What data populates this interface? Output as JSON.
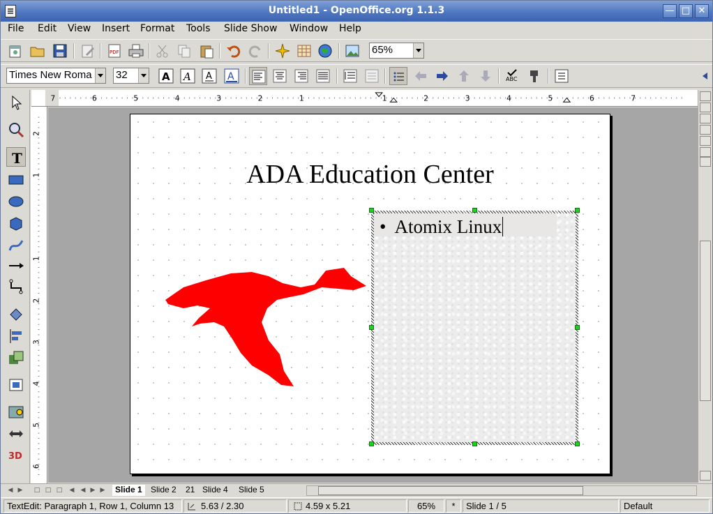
{
  "window": {
    "title": "Untitled1 - OpenOffice.org 1.1.3"
  },
  "menu": [
    "File",
    "Edit",
    "View",
    "Insert",
    "Format",
    "Tools",
    "Slide Show",
    "Window",
    "Help"
  ],
  "toolbar": {
    "zoom_value": "65%"
  },
  "format_bar": {
    "font_name": "Times New Roma",
    "font_size": "32"
  },
  "rulers": {
    "horizontal_ticks": [
      "7",
      "6",
      "5",
      "4",
      "3",
      "2",
      "1",
      "1",
      "2",
      "3",
      "4",
      "5",
      "6",
      "7"
    ],
    "vertical_ticks": [
      "2",
      "1",
      "1",
      "2",
      "3",
      "4",
      "5",
      "6"
    ]
  },
  "slide": {
    "title": "ADA Education Center",
    "bullet_text": "Atomix Linux",
    "bullet_symbol": "•",
    "figure_color": "#ff0000"
  },
  "tabs": [
    "Slide 1",
    "Slide 2",
    "21",
    "Slide 4",
    "Slide 5"
  ],
  "statusbar": {
    "mode": "TextEdit: Paragraph 1, Row 1, Column 13",
    "position": "5.63 / 2.30",
    "size": "4.59 x 5.21",
    "zoom": "65%",
    "modified": "*",
    "slide_info": "Slide 1 / 5",
    "layout": "Default"
  }
}
